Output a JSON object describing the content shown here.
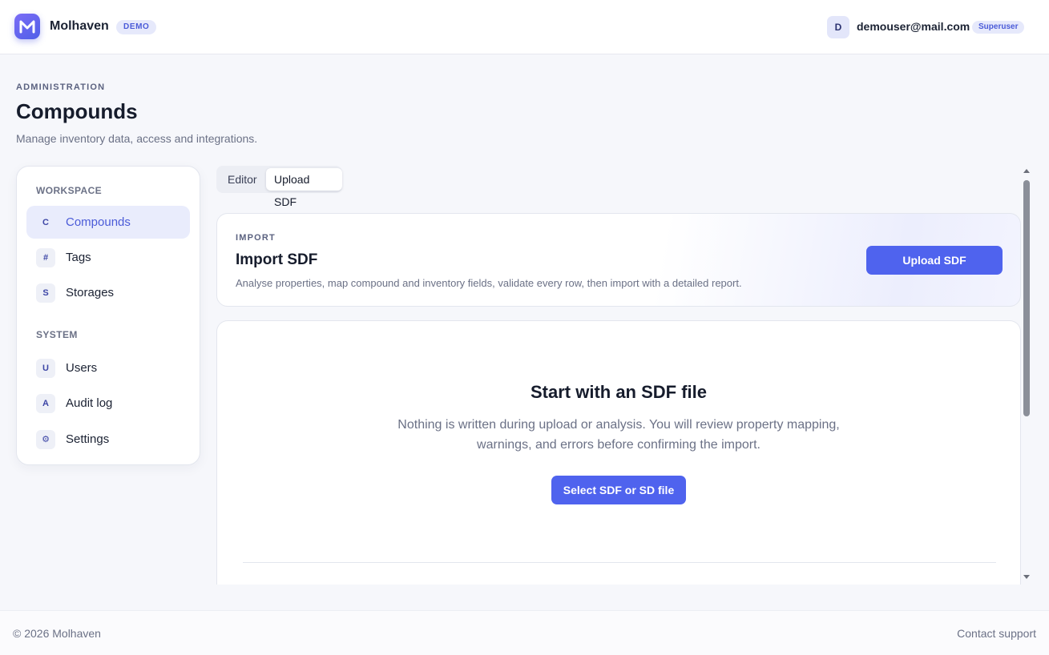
{
  "header": {
    "brand": "Molhaven",
    "demo_badge": "DEMO",
    "user_initial": "D",
    "user_email": "demouser@mail.com",
    "user_role": "Superuser"
  },
  "page": {
    "eyebrow": "ADMINISTRATION",
    "title": "Compounds",
    "subtitle": "Manage inventory data, access and integrations."
  },
  "sidebar": {
    "workspace_label": "WORKSPACE",
    "system_label": "SYSTEM",
    "workspace_items": [
      {
        "icon": "C",
        "label": "Compounds",
        "active": true
      },
      {
        "icon": "#",
        "label": "Tags"
      },
      {
        "icon": "S",
        "label": "Storages"
      }
    ],
    "system_items": [
      {
        "icon": "U",
        "label": "Users"
      },
      {
        "icon": "A",
        "label": "Audit log"
      },
      {
        "icon": "⚙",
        "label": "Settings"
      }
    ]
  },
  "tabs": [
    {
      "label": "Editor"
    },
    {
      "label": "Upload SDF",
      "active": true
    }
  ],
  "import_card": {
    "eyebrow": "IMPORT",
    "title": "Import SDF",
    "description": "Analyse properties, map compound and inventory fields, validate every row, then import with a detailed report.",
    "button": "Upload SDF"
  },
  "dropzone": {
    "title": "Start with an SDF file",
    "description": "Nothing is written during upload or analysis. You will review property mapping, warnings, and errors before confirming the import.",
    "button": "Select SDF or SD file"
  },
  "footer": {
    "copyright": "© 2026 Molhaven",
    "contact": "Contact support"
  },
  "colors": {
    "accent": "#4f63ee",
    "active_bg": "#e9ecfc",
    "page_bg": "#f6f7fb"
  }
}
